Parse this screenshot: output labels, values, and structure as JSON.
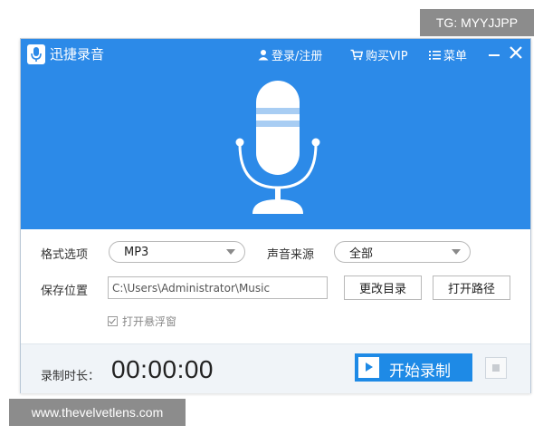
{
  "watermarks": {
    "top": "TG: MYYJJPP",
    "bottom": "www.thevelvetlens.com"
  },
  "app": {
    "title": "迅捷录音",
    "titlebar": {
      "login": "登录/注册",
      "buy_vip": "购买VIP",
      "menu": "菜单"
    }
  },
  "settings": {
    "format_label": "格式选项",
    "format_value": "MP3",
    "source_label": "声音来源",
    "source_value": "全部",
    "save_label": "保存位置",
    "save_path": "C:\\Users\\Administrator\\Music",
    "change_dir_button": "更改目录",
    "open_path_button": "打开路径",
    "floating_window_checkbox": "打开悬浮窗",
    "floating_window_checked": true
  },
  "footer": {
    "duration_label": "录制时长：",
    "duration_value": "00:00:00",
    "start_button": "开始录制"
  },
  "colors": {
    "header_blue": "#2c8ae8",
    "button_blue": "#1e8ae6"
  }
}
